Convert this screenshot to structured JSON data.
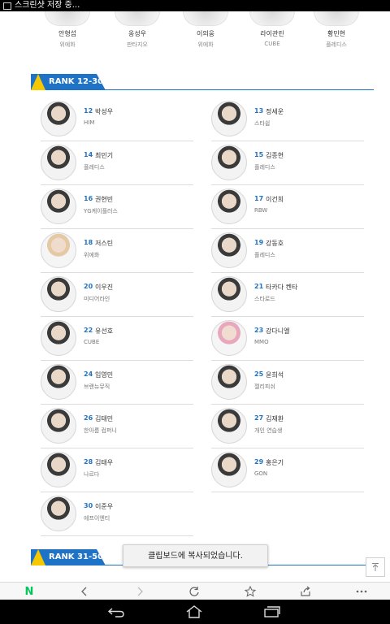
{
  "status_bar": {
    "text": "스크린샷 저장 중..."
  },
  "top_row": [
    {
      "name": "안형섭",
      "agency": "위에화"
    },
    {
      "name": "옹성우",
      "agency": "판타지오"
    },
    {
      "name": "이의웅",
      "agency": "위에화"
    },
    {
      "name": "라이관린",
      "agency": "CUBE"
    },
    {
      "name": "황민현",
      "agency": "플레디스"
    }
  ],
  "sections": [
    {
      "label": "RANK 12-30"
    },
    {
      "label": "RANK 31-50"
    }
  ],
  "trainees": [
    {
      "rank": "12",
      "name": "박성우",
      "agency": "HIM"
    },
    {
      "rank": "13",
      "name": "정세운",
      "agency": "스타쉽"
    },
    {
      "rank": "14",
      "name": "최민기",
      "agency": "플레디스"
    },
    {
      "rank": "15",
      "name": "김종현",
      "agency": "플레디스"
    },
    {
      "rank": "16",
      "name": "권현빈",
      "agency": "YG케이플러스"
    },
    {
      "rank": "17",
      "name": "이건희",
      "agency": "RBW"
    },
    {
      "rank": "18",
      "name": "저스틴",
      "agency": "위에화"
    },
    {
      "rank": "19",
      "name": "강동호",
      "agency": "플레디스"
    },
    {
      "rank": "20",
      "name": "이우진",
      "agency": "미디어라인"
    },
    {
      "rank": "21",
      "name": "타카다 켄타",
      "agency": "스타로드"
    },
    {
      "rank": "22",
      "name": "유선호",
      "agency": "CUBE"
    },
    {
      "rank": "23",
      "name": "강다니엘",
      "agency": "MMO"
    },
    {
      "rank": "24",
      "name": "임영민",
      "agency": "브랜뉴뮤직"
    },
    {
      "rank": "25",
      "name": "윤희석",
      "agency": "젤리피쉬"
    },
    {
      "rank": "26",
      "name": "김태민",
      "agency": "한아름 컴퍼니"
    },
    {
      "rank": "27",
      "name": "김재환",
      "agency": "개인 연습생"
    },
    {
      "rank": "28",
      "name": "김태우",
      "agency": "나르다"
    },
    {
      "rank": "29",
      "name": "홍은기",
      "agency": "GON"
    },
    {
      "rank": "30",
      "name": "이준우",
      "agency": "에프이엔티"
    }
  ],
  "toast": {
    "text": "클립보드에 복사되었습니다."
  },
  "browser_bar": {
    "logo": "N",
    "icons": [
      "back-icon",
      "forward-icon",
      "refresh-icon",
      "star-icon",
      "share-icon",
      "more-icon"
    ]
  },
  "nav_bar": {
    "icons": [
      "back-icon",
      "home-icon",
      "recents-icon"
    ]
  },
  "colors": {
    "accent": "#1f73c6",
    "banner_triangle": "#f5c800",
    "naver_green": "#03c75a"
  }
}
